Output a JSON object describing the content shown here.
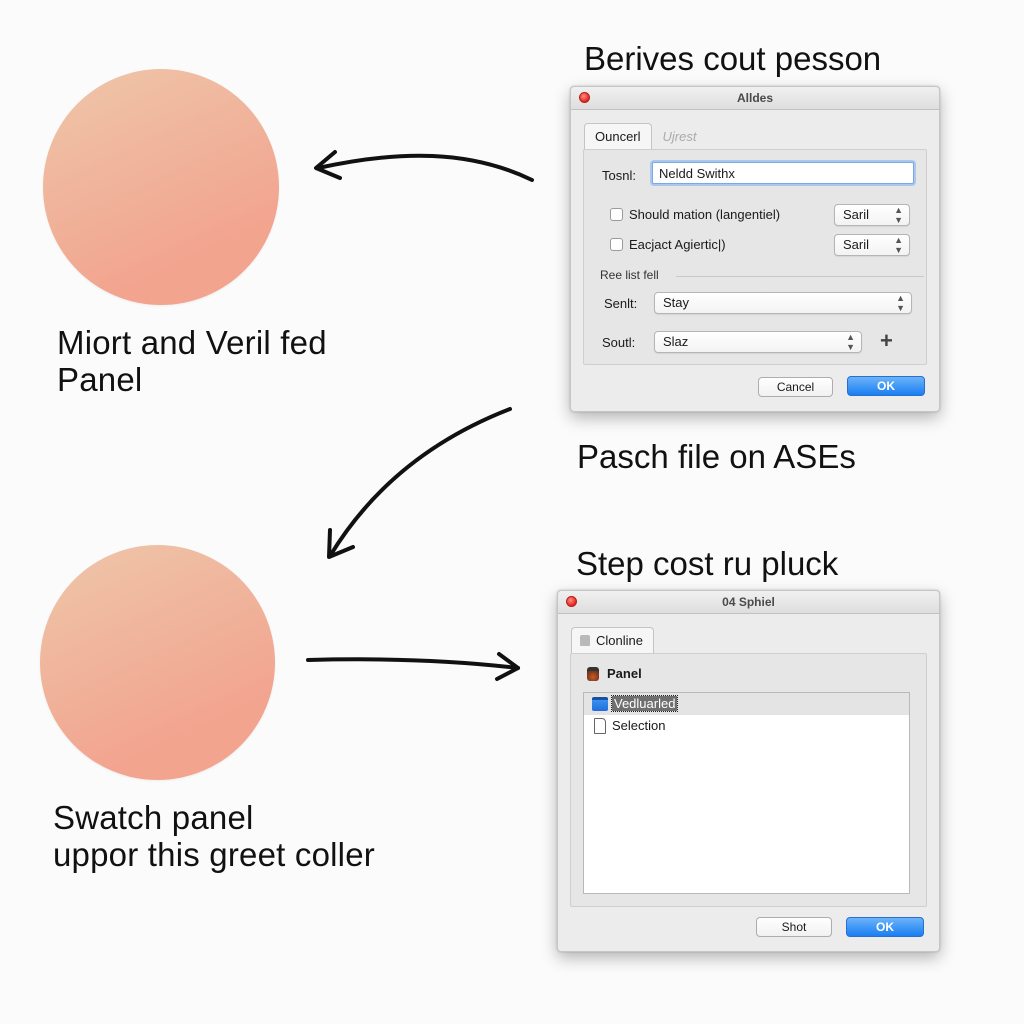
{
  "top_section": {
    "swatch_color_start": "#eec7aa",
    "swatch_color_end": "#f2a48f",
    "caption_line1": "Miort and Veril fed",
    "caption_line2": "Panel",
    "heading": "Berives cout pesson",
    "dialog": {
      "title": "Alldes",
      "tabs": [
        {
          "label": "Ouncerl",
          "active": true
        },
        {
          "label": "Ujrest",
          "active": false
        }
      ],
      "name_label": "Tosnl:",
      "name_value": "Neldd Swithx",
      "checkboxes": [
        {
          "label": "Should mation (langentiel)",
          "checked": false,
          "select_value": "Saril"
        },
        {
          "label": "Eacjact Agiertic|)",
          "checked": false,
          "select_value": "Saril"
        }
      ],
      "section_label": "Ree list fell",
      "selects": [
        {
          "label": "Senlt:",
          "value": "Stay"
        },
        {
          "label": "Soutl:",
          "value": "Slaz"
        }
      ],
      "add_icon": "plus-icon",
      "cancel_label": "Cancel",
      "ok_label": "OK"
    },
    "footer_text": "Pasch file on ASEs"
  },
  "bottom_section": {
    "swatch_color_start": "#eec7aa",
    "swatch_color_end": "#f2a48f",
    "caption_line1": "Swatch panel",
    "caption_line2": "uppor this greet coller",
    "heading": "Step cost ru pluck",
    "dialog": {
      "title": "04 Sphiel",
      "tab_label": "Clonline",
      "tab_icon": "lock-icon",
      "panel_label": "Panel",
      "panel_icon": "character-icon",
      "list_items": [
        {
          "label": "Vedluarled",
          "icon": "folder-icon",
          "selected": true
        },
        {
          "label": "Selection",
          "icon": "document-icon",
          "selected": false
        }
      ],
      "secondary_label": "Shot",
      "ok_label": "OK"
    }
  },
  "colors": {
    "primary_button": "#1a7ef2",
    "close_button": "#e0281f",
    "arrow": "#111111"
  }
}
